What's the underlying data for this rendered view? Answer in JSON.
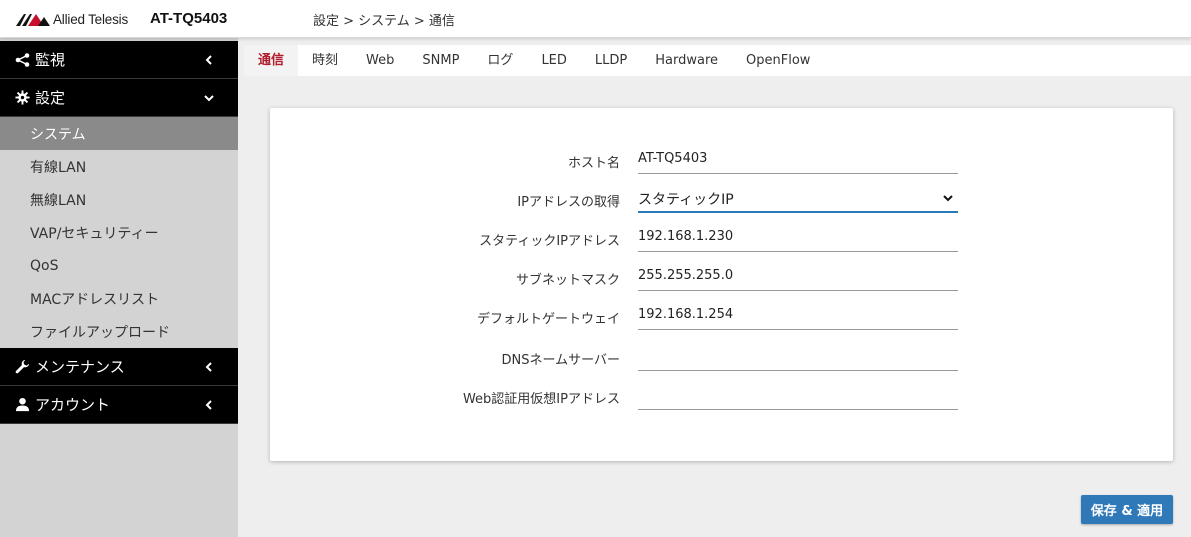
{
  "header": {
    "brand": "Allied Telesis",
    "model": "AT-TQ5403",
    "breadcrumb": "設定 > システム > 通信"
  },
  "sidebar": {
    "groups": [
      {
        "label": "監視",
        "icon": "share-icon",
        "expanded": false
      },
      {
        "label": "設定",
        "icon": "gear-icon",
        "expanded": true
      },
      {
        "label": "メンテナンス",
        "icon": "wrench-icon",
        "expanded": false
      },
      {
        "label": "アカウント",
        "icon": "user-icon",
        "expanded": false
      }
    ],
    "settings_items": [
      {
        "label": "システム",
        "active": true
      },
      {
        "label": "有線LAN",
        "active": false
      },
      {
        "label": "無線LAN",
        "active": false
      },
      {
        "label": "VAP/セキュリティー",
        "active": false
      },
      {
        "label": "QoS",
        "active": false
      },
      {
        "label": "MACアドレスリスト",
        "active": false
      },
      {
        "label": "ファイルアップロード",
        "active": false
      }
    ]
  },
  "tabs": [
    {
      "label": "通信",
      "active": true
    },
    {
      "label": "時刻",
      "active": false
    },
    {
      "label": "Web",
      "active": false
    },
    {
      "label": "SNMP",
      "active": false
    },
    {
      "label": "ログ",
      "active": false
    },
    {
      "label": "LED",
      "active": false
    },
    {
      "label": "LLDP",
      "active": false
    },
    {
      "label": "Hardware",
      "active": false
    },
    {
      "label": "OpenFlow",
      "active": false
    }
  ],
  "form": {
    "hostname": {
      "label": "ホスト名",
      "value": "AT-TQ5403"
    },
    "ip_mode": {
      "label": "IPアドレスの取得",
      "value": "スタティックIP"
    },
    "static_ip": {
      "label": "スタティックIPアドレス",
      "value": "192.168.1.230"
    },
    "subnet": {
      "label": "サブネットマスク",
      "value": "255.255.255.0"
    },
    "gateway": {
      "label": "デフォルトゲートウェイ",
      "value": "192.168.1.254"
    },
    "dns": {
      "label": "DNSネームサーバー",
      "value": ""
    },
    "web_auth_ip": {
      "label": "Web認証用仮想IPアドレス",
      "value": ""
    }
  },
  "actions": {
    "save_label": "保存 & 適用"
  },
  "colors": {
    "accent": "#2f79b8",
    "active_tab": "#b01e2e",
    "brand_red": "#c8102e"
  }
}
